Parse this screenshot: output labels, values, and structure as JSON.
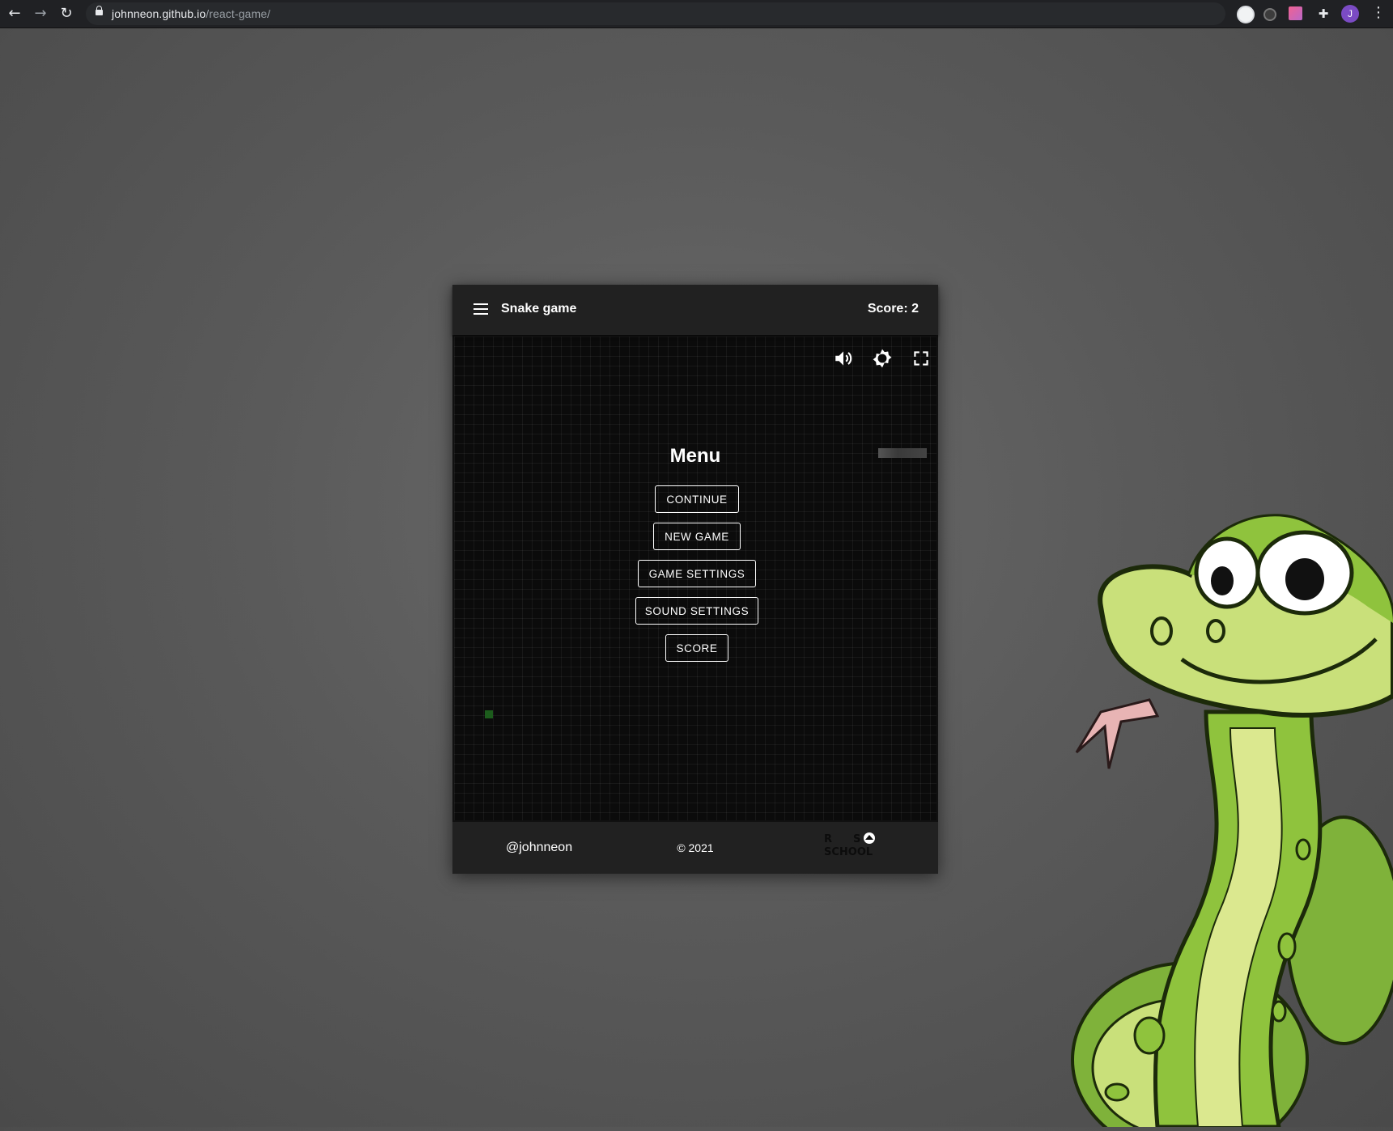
{
  "browser": {
    "url_host": "johnneon.github.io",
    "url_path": "/react-game/",
    "profile_initial": "J"
  },
  "app": {
    "title": "Snake game",
    "score_text": "Score: 2"
  },
  "controls": {
    "sound_icon": "volume-icon",
    "theme_icon": "brightness-icon",
    "fullscreen_icon": "fullscreen-icon"
  },
  "menu": {
    "title": "Menu",
    "items": [
      {
        "label": "CONTINUE"
      },
      {
        "label": "NEW GAME"
      },
      {
        "label": "GAME SETTINGS"
      },
      {
        "label": "SOUND SETTINGS"
      },
      {
        "label": "SCORE"
      }
    ]
  },
  "footer": {
    "author": "@johnneon",
    "copyright": "© 2021"
  },
  "colors": {
    "app_bar": "#212121",
    "field": "#0b0b0b",
    "food": "#1c5c1c",
    "snake_body": "#a8cf45"
  }
}
